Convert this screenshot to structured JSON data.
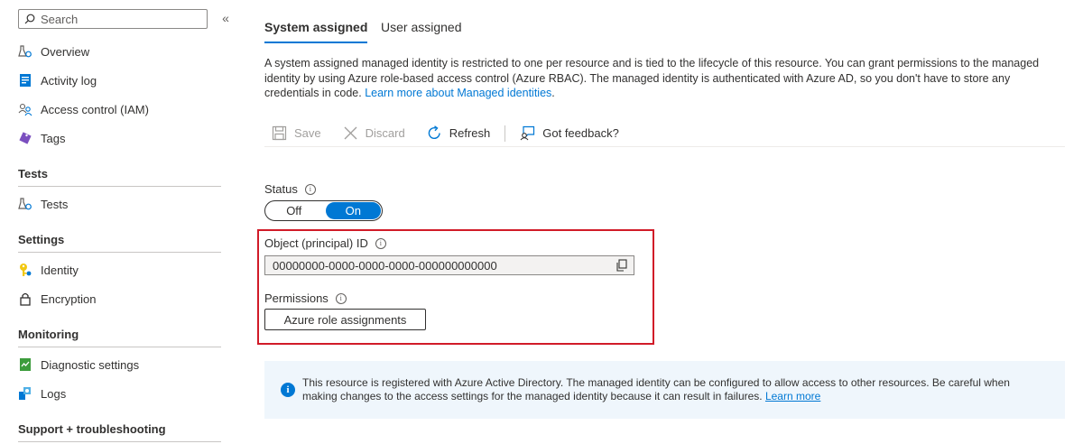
{
  "sidebar": {
    "search_placeholder": "Search",
    "collapse_glyph": "«",
    "items_top": [
      {
        "label": "Overview",
        "icon": "overview-icon"
      },
      {
        "label": "Activity log",
        "icon": "activity-log-icon"
      },
      {
        "label": "Access control (IAM)",
        "icon": "iam-icon"
      },
      {
        "label": "Tags",
        "icon": "tag-icon"
      }
    ],
    "sections": [
      {
        "title": "Tests",
        "items": [
          {
            "label": "Tests",
            "icon": "tests-icon"
          }
        ]
      },
      {
        "title": "Settings",
        "items": [
          {
            "label": "Identity",
            "icon": "identity-key-icon"
          },
          {
            "label": "Encryption",
            "icon": "lock-icon"
          }
        ]
      },
      {
        "title": "Monitoring",
        "items": [
          {
            "label": "Diagnostic settings",
            "icon": "diagnostic-icon"
          },
          {
            "label": "Logs",
            "icon": "logs-icon"
          }
        ]
      },
      {
        "title": "Support + troubleshooting",
        "items": []
      }
    ]
  },
  "tabs": [
    {
      "label": "System assigned",
      "active": true
    },
    {
      "label": "User assigned",
      "active": false
    }
  ],
  "description": {
    "text": "A system assigned managed identity is restricted to one per resource and is tied to the lifecycle of this resource. You can grant permissions to the managed identity by using Azure role-based access control (Azure RBAC). The managed identity is authenticated with Azure AD, so you don't have to store any credentials in code. ",
    "link": "Learn more about Managed identities",
    "suffix": "."
  },
  "toolbar": {
    "save": "Save",
    "discard": "Discard",
    "refresh": "Refresh",
    "feedback": "Got feedback?"
  },
  "status": {
    "label": "Status",
    "off": "Off",
    "on": "On",
    "value": "On"
  },
  "object_id": {
    "label": "Object (principal) ID",
    "value": "00000000-0000-0000-0000-000000000000"
  },
  "permissions": {
    "label": "Permissions",
    "button": "Azure role assignments"
  },
  "banner": {
    "text": "This resource is registered with Azure Active Directory. The managed identity can be configured to allow access to other resources. Be careful when making changes to the access settings for the managed identity because it can result in failures. ",
    "link": "Learn more"
  },
  "colors": {
    "accent": "#0078d4",
    "highlight": "#d11b28",
    "banner_bg": "#eff6fc"
  }
}
